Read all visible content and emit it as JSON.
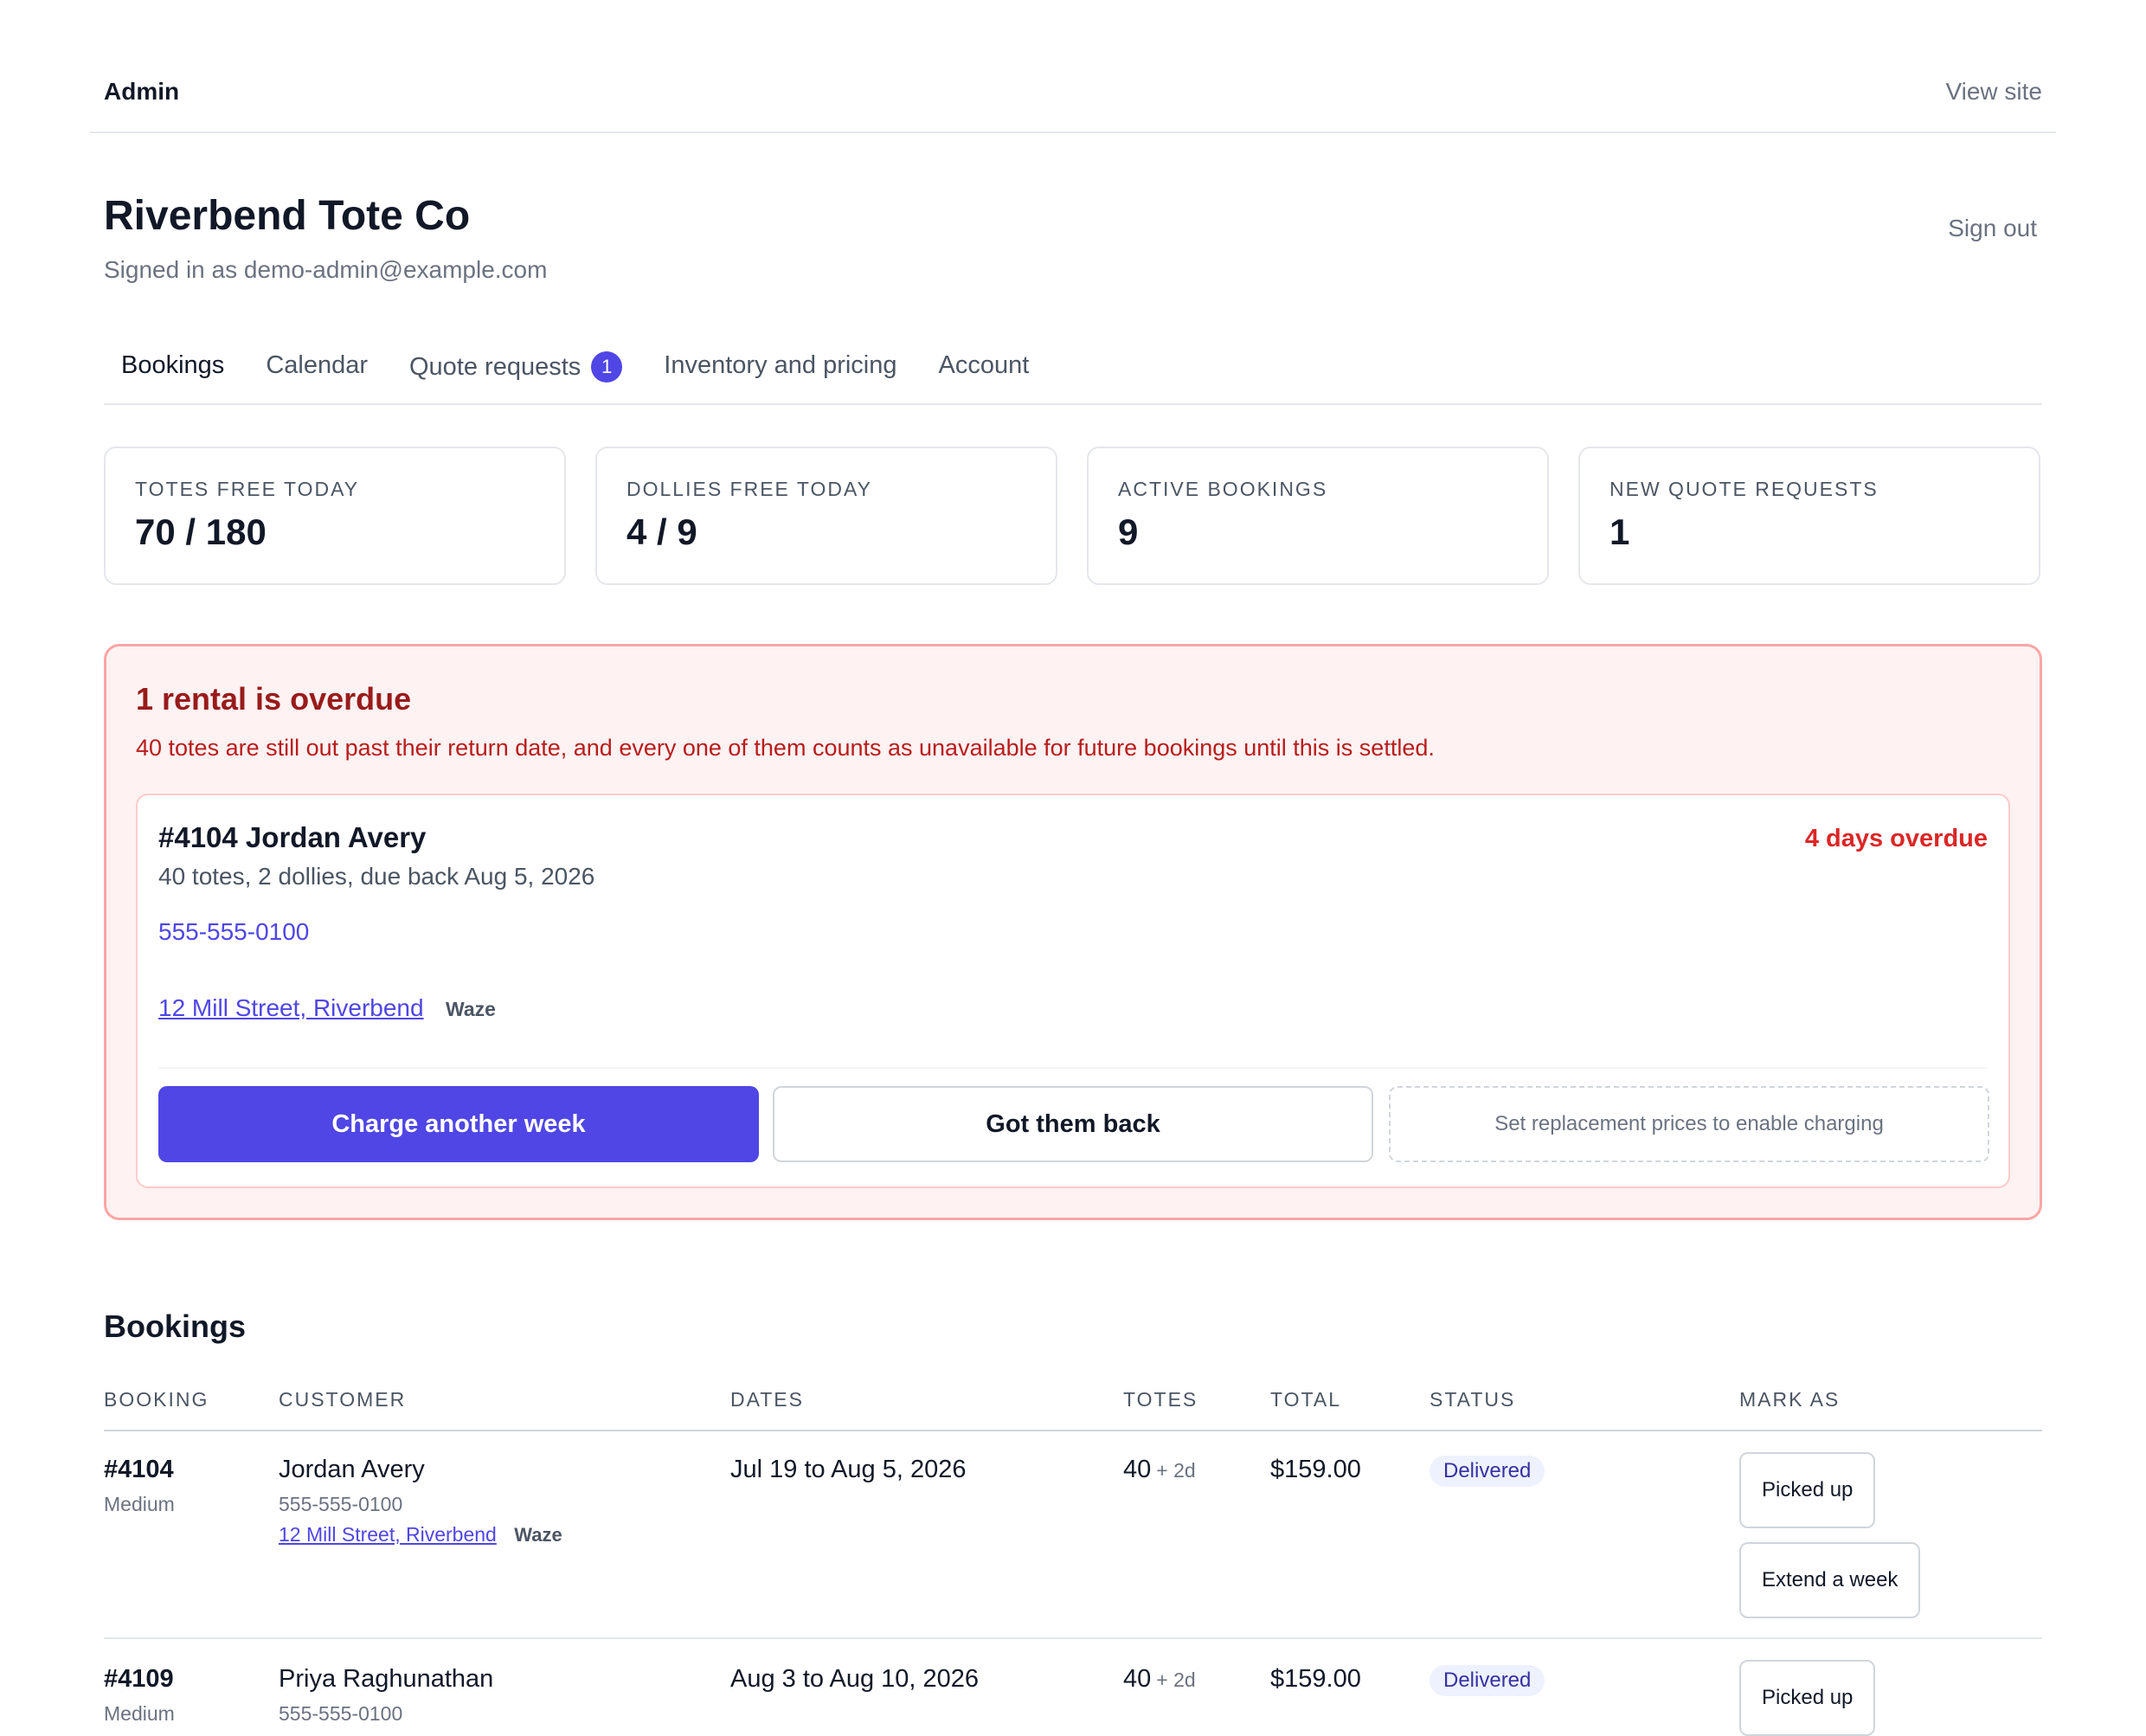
{
  "topbar": {
    "admin": "Admin",
    "view_site": "View site"
  },
  "header": {
    "company": "Riverbend Tote Co",
    "signed_in": "Signed in as demo-admin@example.com",
    "sign_out": "Sign out"
  },
  "tabs": [
    {
      "label": "Bookings",
      "active": true
    },
    {
      "label": "Calendar"
    },
    {
      "label": "Quote requests",
      "badge": "1"
    },
    {
      "label": "Inventory and pricing"
    },
    {
      "label": "Account"
    }
  ],
  "stats": [
    {
      "label": "TOTES FREE TODAY",
      "value": "70 / 180"
    },
    {
      "label": "DOLLIES FREE TODAY",
      "value": "4 / 9"
    },
    {
      "label": "ACTIVE BOOKINGS",
      "value": "9"
    },
    {
      "label": "NEW QUOTE REQUESTS",
      "value": "1"
    }
  ],
  "overdue": {
    "title": "1 rental is overdue",
    "description": "40 totes are still out past their return date, and every one of them counts as unavailable for future bookings until this is settled.",
    "card": {
      "name": "#4104 Jordan Avery",
      "meta": "40 totes, 2 dollies, due back Aug 5, 2026",
      "phone": "555-555-0100",
      "address": "12 Mill Street, Riverbend",
      "waze": "Waze",
      "overdue_label": "4 days overdue",
      "charge_button": "Charge another week",
      "got_back_button": "Got them back",
      "replacement_note": "Set replacement prices to enable charging"
    }
  },
  "bookings": {
    "title": "Bookings",
    "columns": [
      "BOOKING",
      "CUSTOMER",
      "DATES",
      "TOTES",
      "TOTAL",
      "STATUS",
      "MARK AS"
    ],
    "rows": [
      {
        "id": "#4104",
        "size": "Medium",
        "customer": "Jordan Avery",
        "phone": "555-555-0100",
        "address": "12 Mill Street, Riverbend",
        "waze": "Waze",
        "dates": "Jul 19 to Aug 5, 2026",
        "totes": "40",
        "totes_extra": "+ 2d",
        "total": "$159.00",
        "status": "Delivered",
        "actions": [
          "Picked up",
          "Extend a week"
        ]
      },
      {
        "id": "#4109",
        "size": "Medium",
        "customer": "Priya Raghunathan",
        "phone": "555-555-0100",
        "dates": "Aug 3 to Aug 10, 2026",
        "totes": "40",
        "totes_extra": "+ 2d",
        "total": "$159.00",
        "status": "Delivered",
        "actions": [
          "Picked up"
        ]
      }
    ]
  },
  "colors": {
    "accent": "#4f46e5",
    "danger": "#dc2626",
    "danger_bg": "#fef2f2",
    "danger_border": "#fca5a5"
  }
}
